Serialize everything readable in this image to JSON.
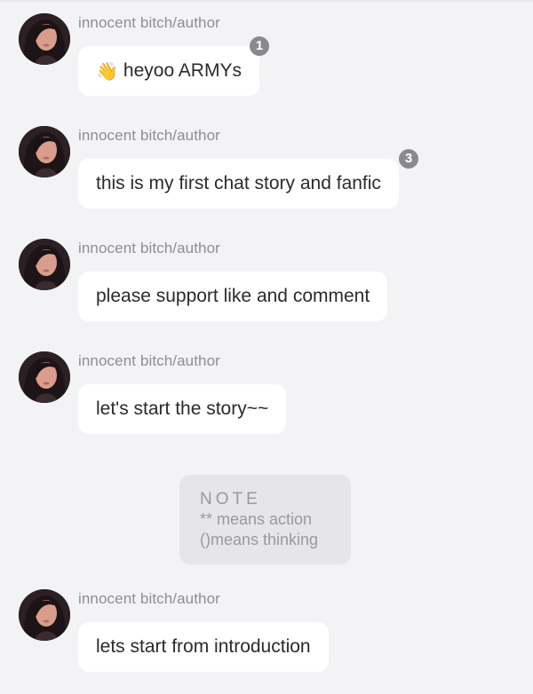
{
  "messages": [
    {
      "author": "innocent bitch/author",
      "text": "heyoo ARMYs",
      "emoji": "👋",
      "badge": "1"
    },
    {
      "author": "innocent bitch/author",
      "text": "this is my first chat story and fanfic",
      "badge": "3"
    },
    {
      "author": "innocent bitch/author",
      "text": "please support like and comment"
    },
    {
      "author": "innocent bitch/author",
      "text": "let's start the story~~"
    },
    {
      "author": "innocent bitch/author",
      "text": "lets start from introduction"
    }
  ],
  "note": {
    "title": "NOTE",
    "lines": [
      "** means action",
      "()means thinking"
    ]
  }
}
